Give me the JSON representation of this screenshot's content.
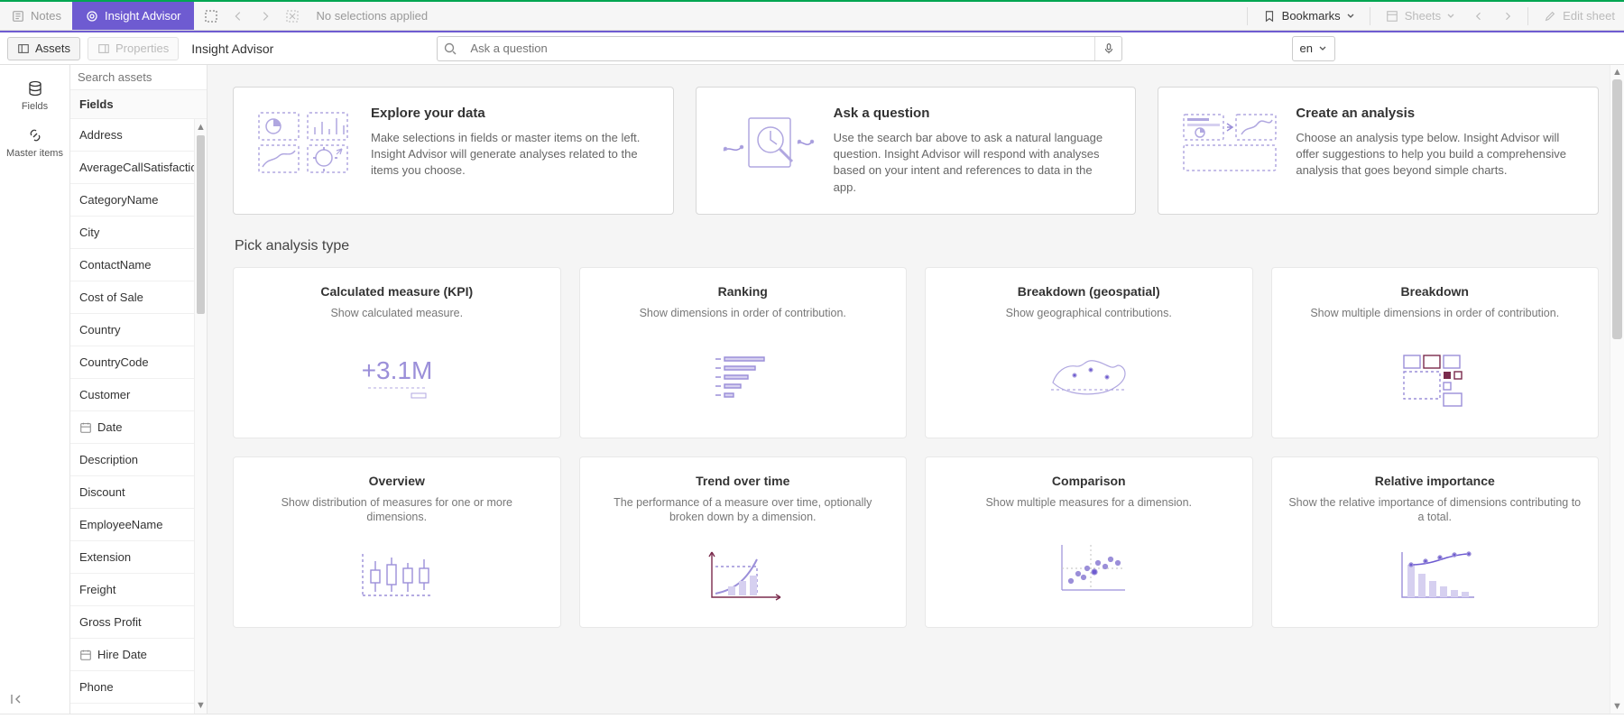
{
  "topbar": {
    "notes": "Notes",
    "insight_advisor": "Insight Advisor",
    "no_selections": "No selections applied",
    "bookmarks": "Bookmarks",
    "sheets": "Sheets",
    "edit_sheet": "Edit sheet"
  },
  "secondbar": {
    "assets": "Assets",
    "properties": "Properties",
    "title": "Insight Advisor",
    "search_placeholder": "Ask a question",
    "lang": "en"
  },
  "rail": {
    "fields": "Fields",
    "master_items": "Master items"
  },
  "fields": {
    "search_placeholder": "Search assets",
    "header": "Fields",
    "items": [
      {
        "label": "Address"
      },
      {
        "label": "AverageCallSatisfaction"
      },
      {
        "label": "CategoryName"
      },
      {
        "label": "City"
      },
      {
        "label": "ContactName"
      },
      {
        "label": "Cost of Sale"
      },
      {
        "label": "Country"
      },
      {
        "label": "CountryCode"
      },
      {
        "label": "Customer"
      },
      {
        "label": "Date",
        "calendar": true
      },
      {
        "label": "Description"
      },
      {
        "label": "Discount"
      },
      {
        "label": "EmployeeName"
      },
      {
        "label": "Extension"
      },
      {
        "label": "Freight"
      },
      {
        "label": "Gross Profit"
      },
      {
        "label": "Hire Date",
        "calendar": true
      },
      {
        "label": "Phone"
      }
    ]
  },
  "intro": [
    {
      "title": "Explore your data",
      "body": "Make selections in fields or master items on the left. Insight Advisor will generate analyses related to the items you choose."
    },
    {
      "title": "Ask a question",
      "body": "Use the search bar above to ask a natural language question. Insight Advisor will respond with analyses based on your intent and references to data in the app."
    },
    {
      "title": "Create an analysis",
      "body": "Choose an analysis type below. Insight Advisor will offer suggestions to help you build a comprehensive analysis that goes beyond simple charts."
    }
  ],
  "section_title": "Pick analysis type",
  "types": [
    {
      "title": "Calculated measure (KPI)",
      "body": "Show calculated measure.",
      "thumb": "kpi"
    },
    {
      "title": "Ranking",
      "body": "Show dimensions in order of contribution.",
      "thumb": "ranking"
    },
    {
      "title": "Breakdown (geospatial)",
      "body": "Show geographical contributions.",
      "thumb": "geo"
    },
    {
      "title": "Breakdown",
      "body": "Show multiple dimensions in order of contribution.",
      "thumb": "treemap"
    },
    {
      "title": "Overview",
      "body": "Show distribution of measures for one or more dimensions.",
      "thumb": "box"
    },
    {
      "title": "Trend over time",
      "body": "The performance of a measure over time, optionally broken down by a dimension.",
      "thumb": "trend"
    },
    {
      "title": "Comparison",
      "body": "Show multiple measures for a dimension.",
      "thumb": "scatter"
    },
    {
      "title": "Relative importance",
      "body": "Show the relative importance of dimensions contributing to a total.",
      "thumb": "pareto"
    }
  ]
}
